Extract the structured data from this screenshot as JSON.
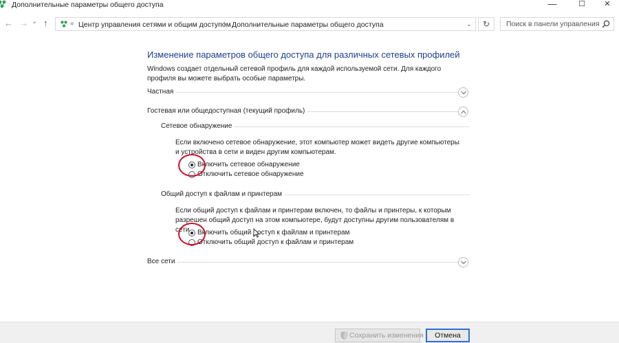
{
  "window": {
    "title": "Дополнительные параметры общего доступа",
    "minimize": "—",
    "maximize": "☐",
    "close": "✕"
  },
  "nav": {
    "back": "←",
    "forward": "→",
    "recent": "⌄",
    "up": "↑"
  },
  "address": {
    "overflow": "«",
    "crumbs": [
      "Центр управления сетями и общим доступом",
      "Дополнительные параметры общего доступа"
    ],
    "separator": "›",
    "dropdown": "⌄",
    "refresh": "↻"
  },
  "search": {
    "placeholder": "Поиск в панели управления"
  },
  "content": {
    "heading": "Изменение параметров общего доступа для различных сетевых профилей",
    "intro": "Windows создает отдельный сетевой профиль для каждой используемой сети. Для каждого профиля вы можете выбрать особые параметры.",
    "profile_private": "Частная",
    "profile_guest": "Гостевая или общедоступная (текущий профиль)",
    "discovery": {
      "title": "Сетевое обнаружение",
      "desc": "Если включено сетевое обнаружение, этот компьютер может видеть другие компьютеры и устройства в сети и виден другим компьютерам.",
      "on": "Включить сетевое обнаружение",
      "off": "Отключить сетевое обнаружение"
    },
    "sharing": {
      "title": "Общий доступ к файлам и принтерам",
      "desc": "Если общий доступ к файлам и принтерам включен, то файлы и принтеры, к которым разрешен общий доступ на этом компьютере, будут доступны другим пользователям в сети.",
      "on": "Включить общий доступ к файлам и принтерам",
      "off": "Отключить общий доступ к файлам и принтерам"
    },
    "all_networks": "Все сети"
  },
  "footer": {
    "save": "Сохранить изменения",
    "cancel": "Отмена"
  },
  "colors": {
    "heading": "#1e3f8c",
    "annotation": "#c8102e",
    "focus_border": "#2f6fd1"
  }
}
